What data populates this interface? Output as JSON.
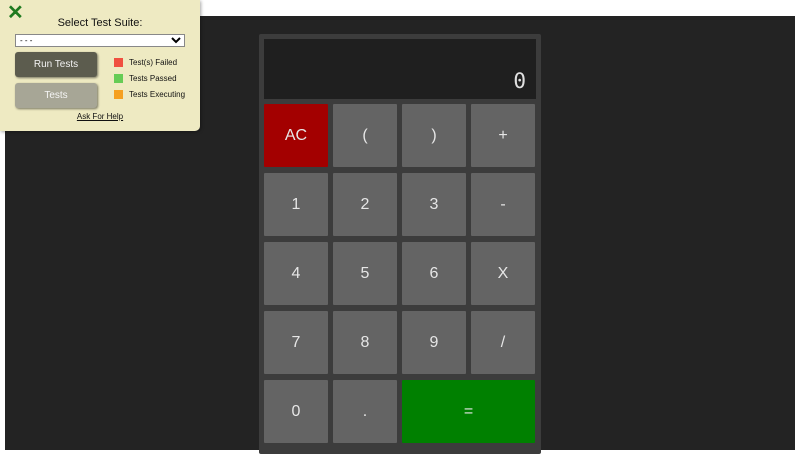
{
  "calculator": {
    "display": "0",
    "keys": [
      "AC",
      "(",
      ")",
      "+",
      "1",
      "2",
      "3",
      "-",
      "4",
      "5",
      "6",
      "X",
      "7",
      "8",
      "9",
      "/",
      "0",
      ".",
      "="
    ]
  },
  "test_panel": {
    "close_icon": "close-icon",
    "title": "Select Test Suite:",
    "suite_select_value": "- - -",
    "run_button": "Run Tests",
    "tests_button": "Tests",
    "legend": [
      {
        "label": "Test(s) Failed",
        "color": "#f05040"
      },
      {
        "label": "Tests Passed",
        "color": "#66cc55"
      },
      {
        "label": "Tests Executing",
        "color": "#f5a020"
      }
    ],
    "help_link": "Ask For Help"
  },
  "colors": {
    "clear_key": "#a30000",
    "equals_key": "#008000",
    "key": "#646464",
    "background": "#232323"
  }
}
